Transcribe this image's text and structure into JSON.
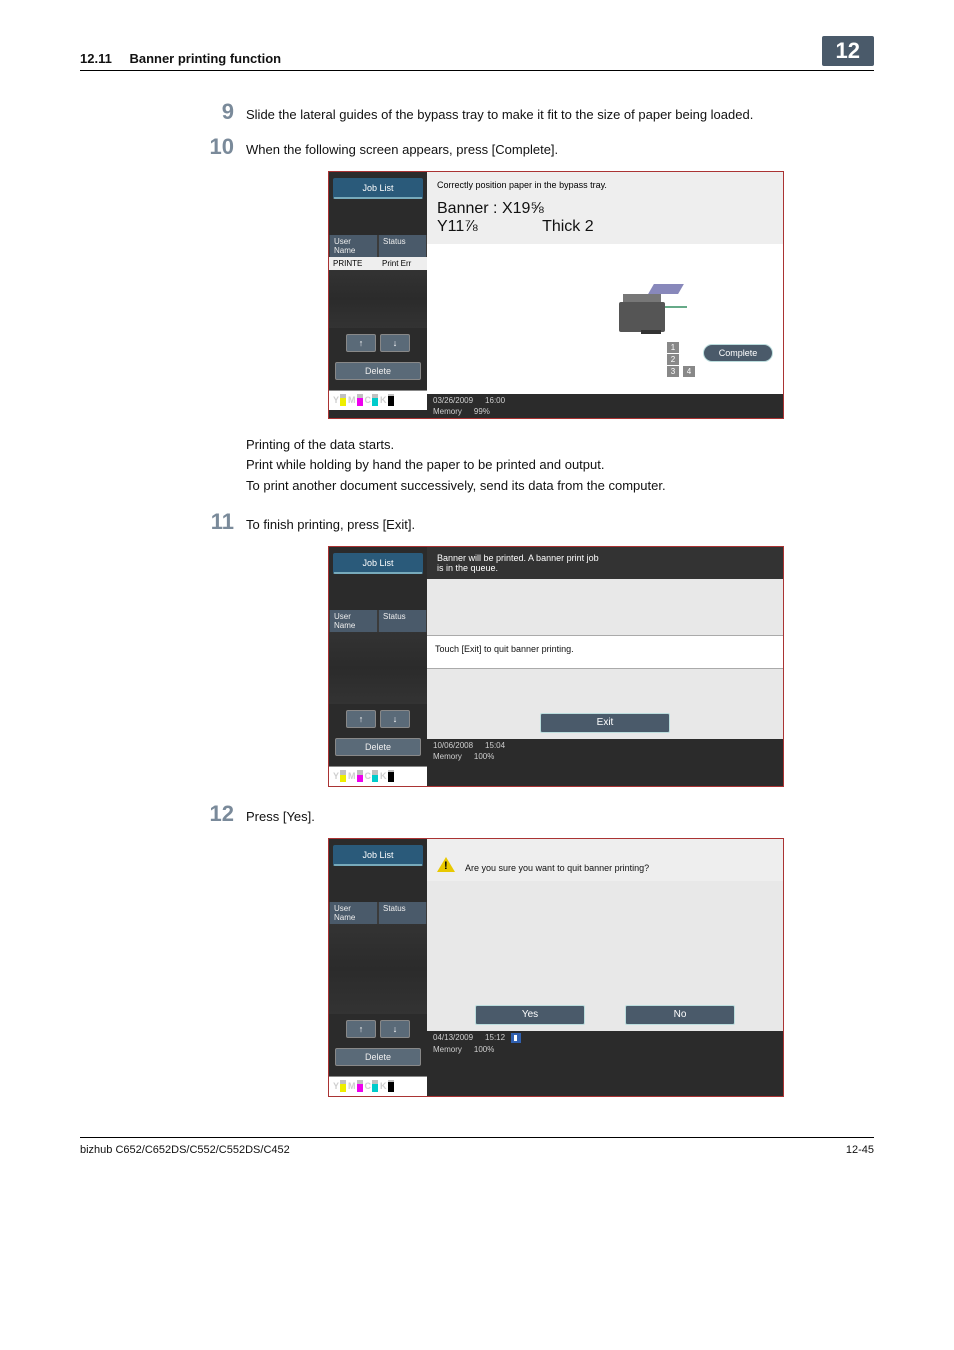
{
  "header": {
    "section_num": "12.11",
    "section_title": "Banner printing function",
    "chapter": "12"
  },
  "steps": {
    "s9": {
      "num": "9",
      "text": "Slide the lateral guides of the bypass tray to make it fit to the size of paper being loaded."
    },
    "s10": {
      "num": "10",
      "text": "When the following screen appears, press [Complete]."
    },
    "s11": {
      "num": "11",
      "text": "To finish printing, press [Exit]."
    },
    "s12": {
      "num": "12",
      "text": "Press [Yes]."
    }
  },
  "post10": {
    "l1": "Printing of the data starts.",
    "l2": "Print while holding by hand the paper to be printed and output.",
    "l3": "To print another document successively, send its data from the computer."
  },
  "shot_common": {
    "job_list": "Job List",
    "user_name": "User\nName",
    "status": "Status",
    "row_user": "PRINTE",
    "row_status": "Print Err",
    "delete": "Delete",
    "toner_y": "Y",
    "toner_m": "M",
    "toner_c": "C",
    "toner_k": "K",
    "memory": "Memory"
  },
  "shot1": {
    "msg": "Correctly position paper in the bypass tray.",
    "banner_label": "Banner   :",
    "x": "X19⅝",
    "y": "Y11⅞",
    "thick": "Thick 2",
    "n1": "1",
    "n2": "2",
    "n3": "3",
    "n4": "4",
    "complete": "Complete",
    "date": "03/26/2009",
    "time": "16:00",
    "mem": "99%"
  },
  "shot2": {
    "msg": "Banner will be printed.  A banner print job\nis in the queue.",
    "hint": "Touch [Exit] to quit banner printing.",
    "exit": "Exit",
    "date": "10/06/2008",
    "time": "15:04",
    "mem": "100%"
  },
  "shot3": {
    "msg": "Are you sure you want to quit banner printing?",
    "yes": "Yes",
    "no": "No",
    "date": "04/13/2009",
    "time": "15:12",
    "mem": "100%"
  },
  "footer": {
    "model": "bizhub C652/C652DS/C552/C552DS/C452",
    "page": "12-45"
  }
}
